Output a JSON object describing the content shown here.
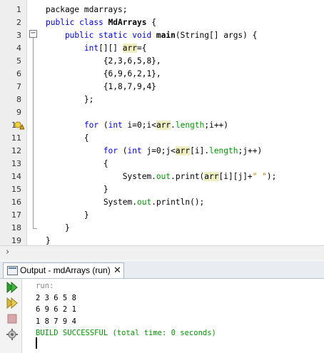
{
  "editor": {
    "lines": [
      {
        "num": "1",
        "segments": [
          {
            "t": "package mdarrays;",
            "c": "plain"
          }
        ]
      },
      {
        "num": "2",
        "segments": [
          {
            "t": "public class ",
            "c": "kw"
          },
          {
            "t": "MdArrays",
            "c": "bold"
          },
          {
            "t": " {",
            "c": "plain"
          }
        ]
      },
      {
        "num": "3",
        "segments": [
          {
            "t": "    public static void ",
            "c": "kw"
          },
          {
            "t": "main",
            "c": "bold"
          },
          {
            "t": "(String[] args) {",
            "c": "plain"
          }
        ]
      },
      {
        "num": "4",
        "segments": [
          {
            "t": "        int",
            "c": "kw"
          },
          {
            "t": "[][] ",
            "c": "plain"
          },
          {
            "t": "arr",
            "c": "hl"
          },
          {
            "t": "={",
            "c": "plain"
          }
        ]
      },
      {
        "num": "5",
        "segments": [
          {
            "t": "            {2,3,6,5,8},",
            "c": "plain"
          }
        ]
      },
      {
        "num": "6",
        "segments": [
          {
            "t": "            {6,9,6,2,1},",
            "c": "plain"
          }
        ]
      },
      {
        "num": "7",
        "segments": [
          {
            "t": "            {1,8,7,9,4}",
            "c": "plain"
          }
        ]
      },
      {
        "num": "8",
        "segments": [
          {
            "t": "        };",
            "c": "plain"
          }
        ]
      },
      {
        "num": "9",
        "segments": [
          {
            "t": "",
            "c": "plain"
          }
        ]
      },
      {
        "num": "10",
        "segments": [
          {
            "t": "        for ",
            "c": "kw"
          },
          {
            "t": "(",
            "c": "plain"
          },
          {
            "t": "int ",
            "c": "kw"
          },
          {
            "t": "i=0;i<",
            "c": "plain"
          },
          {
            "t": "arr",
            "c": "hl"
          },
          {
            "t": ".",
            "c": "plain"
          },
          {
            "t": "length",
            "c": "fld"
          },
          {
            "t": ";i++)",
            "c": "plain"
          }
        ]
      },
      {
        "num": "11",
        "segments": [
          {
            "t": "        {",
            "c": "plain"
          }
        ]
      },
      {
        "num": "12",
        "segments": [
          {
            "t": "            for ",
            "c": "kw"
          },
          {
            "t": "(",
            "c": "plain"
          },
          {
            "t": "int ",
            "c": "kw"
          },
          {
            "t": "j=0;j<",
            "c": "plain"
          },
          {
            "t": "arr",
            "c": "hl"
          },
          {
            "t": "[i].",
            "c": "plain"
          },
          {
            "t": "length",
            "c": "fld"
          },
          {
            "t": ";j++)",
            "c": "plain"
          }
        ]
      },
      {
        "num": "13",
        "segments": [
          {
            "t": "            {",
            "c": "plain"
          }
        ]
      },
      {
        "num": "14",
        "segments": [
          {
            "t": "                System.",
            "c": "plain"
          },
          {
            "t": "out",
            "c": "fld"
          },
          {
            "t": ".print(",
            "c": "plain"
          },
          {
            "t": "arr",
            "c": "hl"
          },
          {
            "t": "[i][j]+",
            "c": "plain"
          },
          {
            "t": "\" \"",
            "c": "str"
          },
          {
            "t": ");",
            "c": "plain"
          }
        ]
      },
      {
        "num": "15",
        "segments": [
          {
            "t": "            }",
            "c": "plain"
          }
        ]
      },
      {
        "num": "16",
        "segments": [
          {
            "t": "            System.",
            "c": "plain"
          },
          {
            "t": "out",
            "c": "fld"
          },
          {
            "t": ".println();",
            "c": "plain"
          }
        ]
      },
      {
        "num": "17",
        "segments": [
          {
            "t": "        }",
            "c": "plain"
          }
        ]
      },
      {
        "num": "18",
        "segments": [
          {
            "t": "    }",
            "c": "plain"
          }
        ]
      },
      {
        "num": "19",
        "segments": [
          {
            "t": "}",
            "c": "plain"
          }
        ]
      }
    ],
    "warning_line": "10",
    "warning_icon": "warning-bulb-icon"
  },
  "output": {
    "tab_label": "Output - mdArrays (run)",
    "close_symbol": "✕",
    "lines": [
      {
        "text": "run:",
        "c": "run-label"
      },
      {
        "text": "2 3 6 5 8",
        "c": "plain"
      },
      {
        "text": "6 9 6 2 1",
        "c": "plain"
      },
      {
        "text": "1 8 7 9 4",
        "c": "plain"
      },
      {
        "text": "BUILD SUCCESSFUL (total time: 0 seconds)",
        "c": "success"
      }
    ],
    "toolbar": [
      "rerun-icon",
      "rerun-with-options-icon",
      "stop-icon",
      "settings-icon"
    ]
  },
  "colors": {
    "keyword": "#0000e6",
    "field": "#009900",
    "string": "#ce7b00",
    "highlight": "#eeeec0",
    "success": "#009900"
  }
}
